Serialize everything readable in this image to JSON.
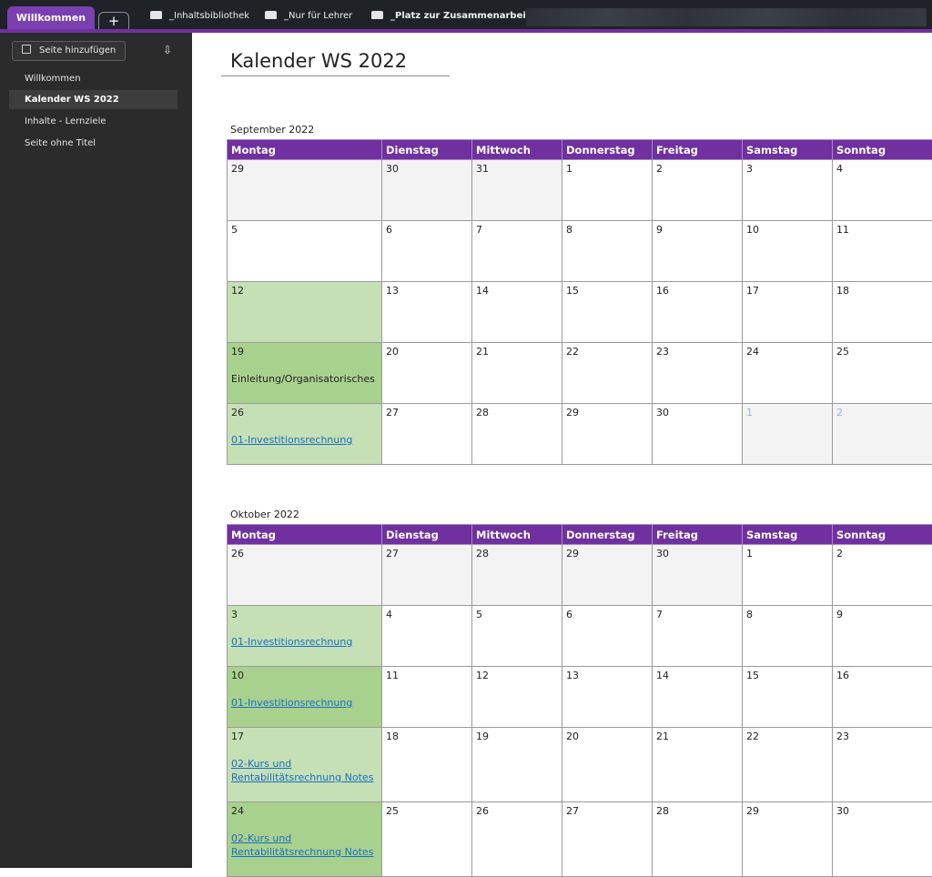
{
  "tabs": {
    "active": "Willkommen",
    "add_label": "+"
  },
  "notebooks": [
    {
      "label": "_Inhaltsbibliothek",
      "bold": false
    },
    {
      "label": "_Nur für Lehrer",
      "bold": false
    },
    {
      "label": "_Platz zur Zusammenarbeit",
      "bold": true
    }
  ],
  "sidebar": {
    "add_page_label": "Seite hinzufügen",
    "sort_icon": "sort-icon",
    "items": [
      {
        "label": "Willkommen",
        "active": false
      },
      {
        "label": "Kalender WS 2022",
        "active": true
      },
      {
        "label": "Inhalte - Lernziele",
        "active": false
      },
      {
        "label": "Seite ohne Titel",
        "active": false
      }
    ]
  },
  "page": {
    "title": "Kalender WS 2022"
  },
  "weekdays": [
    "Montag",
    "Dienstag",
    "Mittwoch",
    "Donnerstag",
    "Freitag",
    "Samstag",
    "Sonntag"
  ],
  "calendars": [
    {
      "month": "September 2022",
      "weeks": [
        [
          {
            "d": "29",
            "other": true
          },
          {
            "d": "30",
            "other": true
          },
          {
            "d": "31",
            "other": true
          },
          {
            "d": "1"
          },
          {
            "d": "2"
          },
          {
            "d": "3",
            "wkend": true
          },
          {
            "d": "4",
            "wkend": true
          }
        ],
        [
          {
            "d": "5"
          },
          {
            "d": "6"
          },
          {
            "d": "7"
          },
          {
            "d": "8"
          },
          {
            "d": "9"
          },
          {
            "d": "10",
            "wkend": true
          },
          {
            "d": "11",
            "wkend": true
          }
        ],
        [
          {
            "d": "12",
            "green": "g1"
          },
          {
            "d": "13"
          },
          {
            "d": "14"
          },
          {
            "d": "15"
          },
          {
            "d": "16"
          },
          {
            "d": "17",
            "wkend": true
          },
          {
            "d": "18",
            "wkend": true
          }
        ],
        [
          {
            "d": "19",
            "green": "g2",
            "note": "Einleitung/Organisatorisches"
          },
          {
            "d": "20"
          },
          {
            "d": "21"
          },
          {
            "d": "22"
          },
          {
            "d": "23"
          },
          {
            "d": "24",
            "wkend": true
          },
          {
            "d": "25",
            "wkend": true
          }
        ],
        [
          {
            "d": "26",
            "green": "g1",
            "link": "01-Investitionsrechnung"
          },
          {
            "d": "27"
          },
          {
            "d": "28"
          },
          {
            "d": "29"
          },
          {
            "d": "30"
          },
          {
            "d": "1",
            "other": true,
            "wkend": true
          },
          {
            "d": "2",
            "other": true,
            "wkend": true
          }
        ]
      ]
    },
    {
      "month": "Oktober 2022",
      "weeks": [
        [
          {
            "d": "26",
            "other": true
          },
          {
            "d": "27",
            "other": true
          },
          {
            "d": "28",
            "other": true
          },
          {
            "d": "29",
            "other": true
          },
          {
            "d": "30",
            "other": true
          },
          {
            "d": "1",
            "wkend": true
          },
          {
            "d": "2",
            "wkend": true
          }
        ],
        [
          {
            "d": "3",
            "green": "g1",
            "link": "01-Investitionsrechnung"
          },
          {
            "d": "4"
          },
          {
            "d": "5"
          },
          {
            "d": "6"
          },
          {
            "d": "7"
          },
          {
            "d": "8",
            "wkend": true
          },
          {
            "d": "9",
            "wkend": true
          }
        ],
        [
          {
            "d": "10",
            "green": "g2",
            "link": "01-Investitionsrechnung"
          },
          {
            "d": "11"
          },
          {
            "d": "12"
          },
          {
            "d": "13"
          },
          {
            "d": "14"
          },
          {
            "d": "15",
            "wkend": true
          },
          {
            "d": "16",
            "wkend": true
          }
        ],
        [
          {
            "d": "17",
            "green": "g1",
            "link": "02-Kurs und Rentabilitätsrechnung Notes"
          },
          {
            "d": "18"
          },
          {
            "d": "19"
          },
          {
            "d": "20"
          },
          {
            "d": "21"
          },
          {
            "d": "22",
            "wkend": true
          },
          {
            "d": "23",
            "wkend": true
          }
        ],
        [
          {
            "d": "24",
            "green": "g2",
            "link": "02-Kurs und Rentabilitätsrechnung Notes"
          },
          {
            "d": "25"
          },
          {
            "d": "26"
          },
          {
            "d": "27"
          },
          {
            "d": "28"
          },
          {
            "d": "29",
            "wkend": true
          },
          {
            "d": "30",
            "wkend": true
          }
        ]
      ]
    }
  ],
  "colors": {
    "accent": "#7030a0",
    "green_light": "#c5e0b4",
    "green_dark": "#a9d18e",
    "weekend_text": "#4a7cc0"
  }
}
